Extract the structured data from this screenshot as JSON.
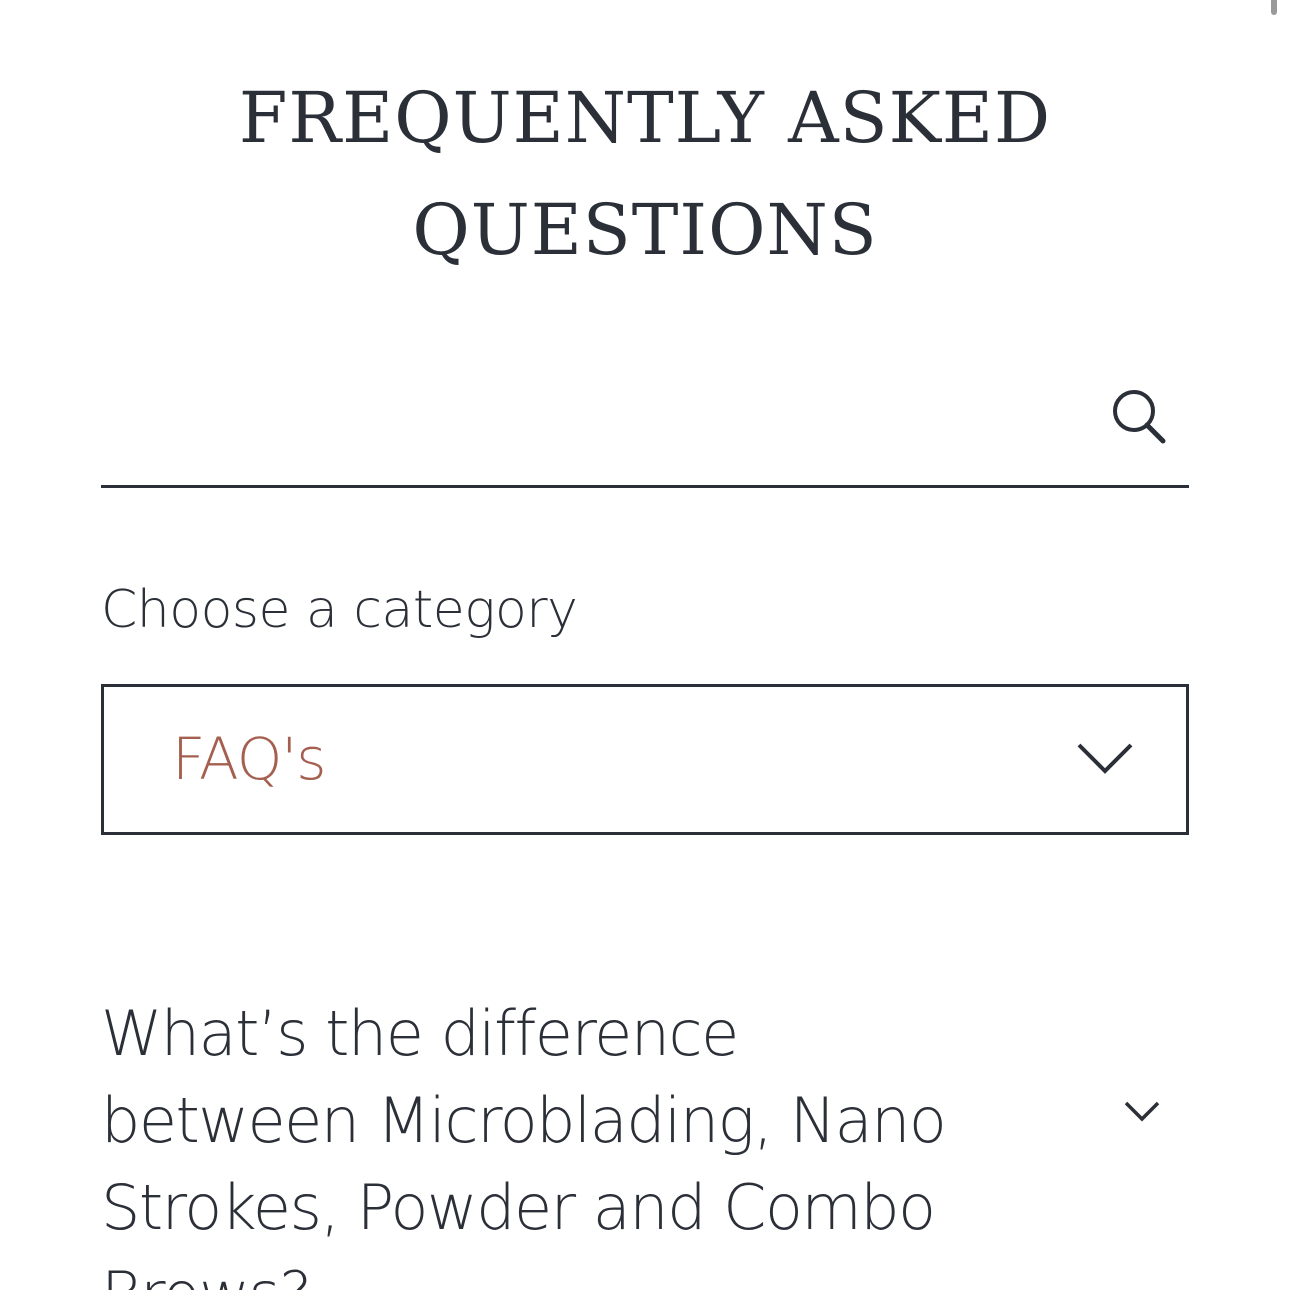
{
  "header": {
    "title_line1": "Frequently Asked",
    "title_line2": "Questions"
  },
  "search": {
    "placeholder": "",
    "icon": "search-icon"
  },
  "category": {
    "label": "Choose a category",
    "selected": "FAQ's",
    "icon": "chevron-down-icon"
  },
  "faq": {
    "items": [
      {
        "question": "What’s the difference between Microblading, Nano Strokes, Powder and Combo Brows?",
        "icon": "chevron-down-icon"
      }
    ]
  },
  "colors": {
    "text": "#2b2f38",
    "accent": "#a45f4f",
    "background": "#ffffff"
  }
}
